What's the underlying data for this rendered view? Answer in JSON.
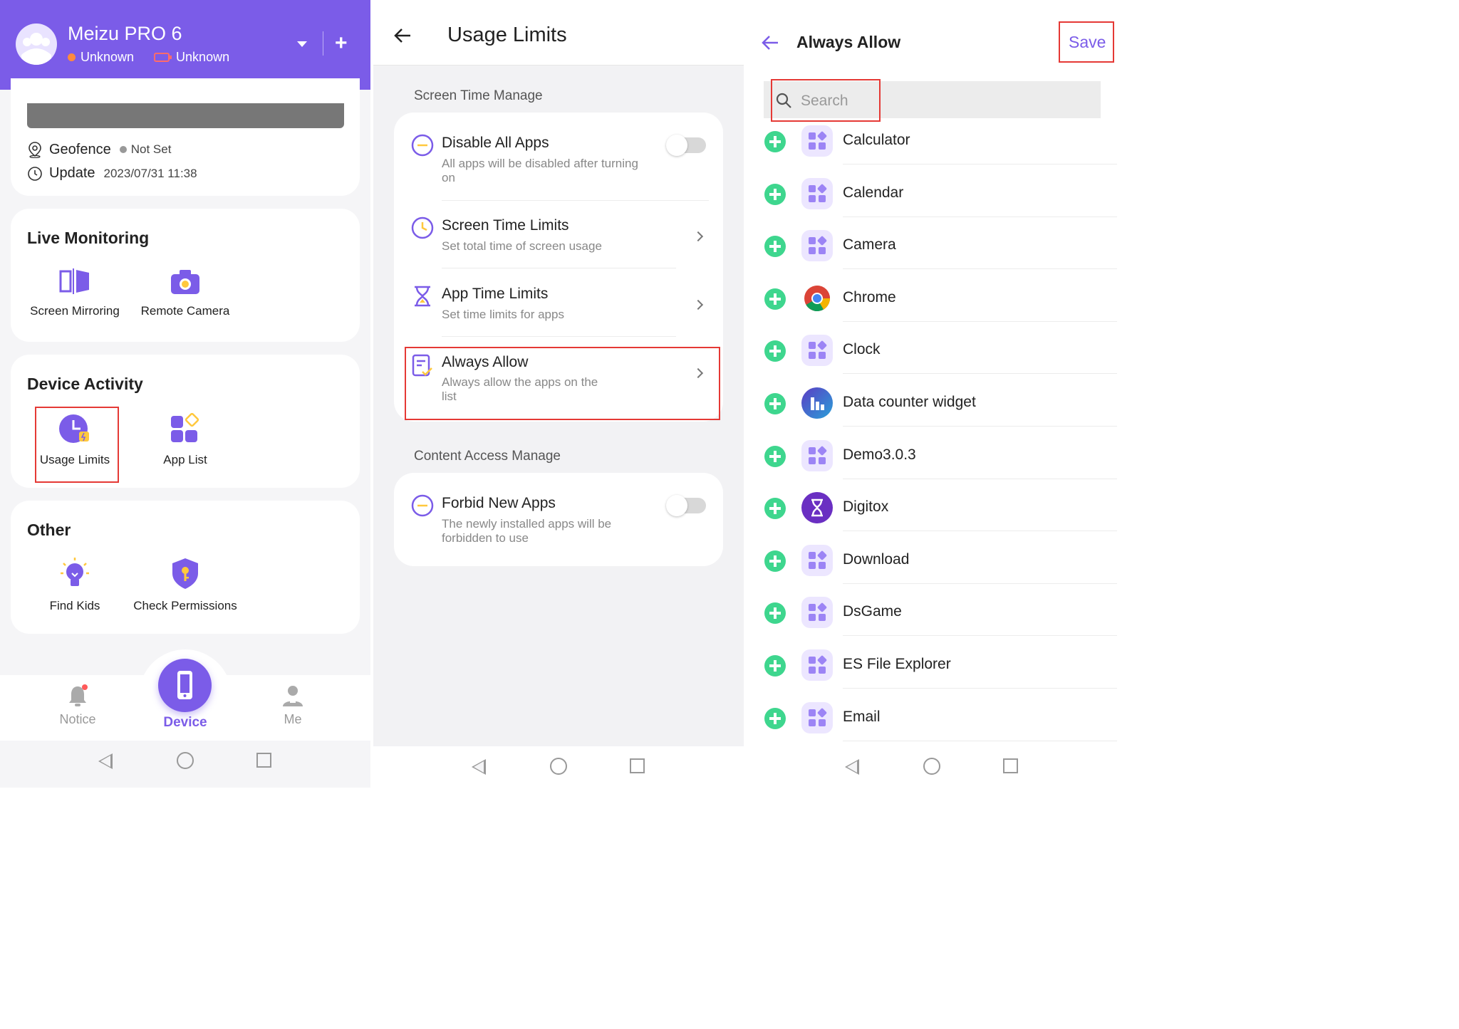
{
  "colors": {
    "accent": "#7b5ce8",
    "highlight_border": "#e53935",
    "add_green": "#3ed68e",
    "battery_red": "#ff6b6b",
    "status_orange": "#ff8a3d"
  },
  "panel1": {
    "device_name": "Meizu PRO 6",
    "status_unknown": "Unknown",
    "battery_unknown": "Unknown",
    "plus": "+",
    "geofence_label": "Geofence",
    "geofence_value": "Not Set",
    "update_label": "Update",
    "update_value": "2023/07/31 11:38",
    "live_monitoring": {
      "title": "Live Monitoring",
      "screen_mirroring": "Screen Mirroring",
      "remote_camera": "Remote Camera"
    },
    "device_activity": {
      "title": "Device Activity",
      "usage_limits": "Usage Limits",
      "app_list": "App List"
    },
    "other": {
      "title": "Other",
      "find_kids": "Find Kids",
      "check_permissions": "Check Permissions"
    },
    "nav": {
      "notice": "Notice",
      "device": "Device",
      "me": "Me"
    }
  },
  "panel2": {
    "title": "Usage Limits",
    "section_screen_time": "Screen Time Manage",
    "disable_all_apps": {
      "title": "Disable All Apps",
      "subtitle_line1": "All apps will be disabled after turning",
      "subtitle_line2": "on",
      "enabled": false
    },
    "screen_time_limits": {
      "title": "Screen Time Limits",
      "subtitle": "Set total time of screen usage"
    },
    "app_time_limits": {
      "title": "App Time Limits",
      "subtitle": "Set time limits for apps"
    },
    "always_allow": {
      "title": "Always Allow",
      "subtitle_line1": "Always allow the apps on the",
      "subtitle_line2": "list"
    },
    "section_content": "Content Access Manage",
    "forbid_new_apps": {
      "title": "Forbid New Apps",
      "subtitle_line1": "The newly installed apps will be",
      "subtitle_line2": "forbidden to use",
      "enabled": false
    }
  },
  "panel3": {
    "title": "Always Allow",
    "save_label": "Save",
    "search_placeholder": "Search",
    "apps": [
      {
        "name": "Calculator",
        "icon": "grid-icon"
      },
      {
        "name": "Calendar",
        "icon": "grid-icon"
      },
      {
        "name": "Camera",
        "icon": "grid-icon"
      },
      {
        "name": "Chrome",
        "icon": "chrome-icon"
      },
      {
        "name": "Clock",
        "icon": "grid-icon"
      },
      {
        "name": "Data counter widget",
        "icon": "data-counter-icon"
      },
      {
        "name": "Demo3.0.3",
        "icon": "grid-icon"
      },
      {
        "name": "Digitox",
        "icon": "hourglass-icon"
      },
      {
        "name": "Download",
        "icon": "grid-icon"
      },
      {
        "name": "DsGame",
        "icon": "grid-icon"
      },
      {
        "name": "ES File Explorer",
        "icon": "grid-icon"
      },
      {
        "name": "Email",
        "icon": "grid-icon"
      }
    ]
  }
}
